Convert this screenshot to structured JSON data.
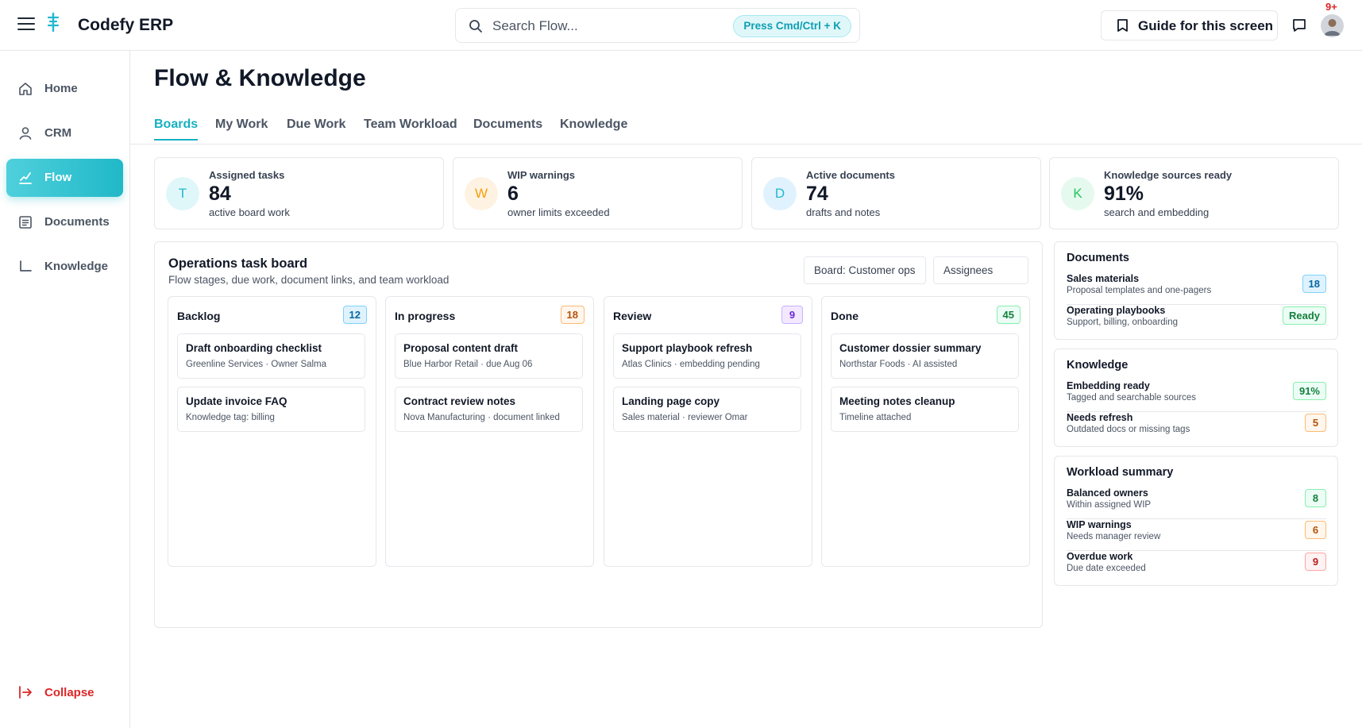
{
  "app": {
    "name": "Codefy ERP",
    "notifications": "9+"
  },
  "search": {
    "placeholder": "Search Flow...",
    "shortcut": "Press Cmd/Ctrl + K"
  },
  "header": {
    "guide_label": "Guide for this screen"
  },
  "sidebar": {
    "items": [
      {
        "label": "Home",
        "icon": "home-icon"
      },
      {
        "label": "CRM",
        "icon": "user-icon"
      },
      {
        "label": "Flow",
        "icon": "flow-icon",
        "active": true
      },
      {
        "label": "Documents",
        "icon": "document-icon"
      },
      {
        "label": "Knowledge",
        "icon": "knowledge-icon"
      }
    ],
    "collapse_label": "Collapse"
  },
  "page": {
    "title": "Flow & Knowledge",
    "tabs": [
      "Boards",
      "My Work",
      "Due Work",
      "Team Workload",
      "Documents",
      "Knowledge"
    ],
    "active_tab": "Boards"
  },
  "stats": [
    {
      "letter": "T",
      "label": "Assigned tasks",
      "value": "84",
      "sub": "active board work",
      "color": "#22b8cf"
    },
    {
      "letter": "W",
      "label": "WIP warnings",
      "value": "6",
      "sub": "owner limits exceeded",
      "color": "#f59e0b"
    },
    {
      "letter": "D",
      "label": "Active documents",
      "value": "74",
      "sub": "drafts and notes",
      "color": "#22b8cf"
    },
    {
      "letter": "K",
      "label": "Knowledge sources ready",
      "value": "91%",
      "sub": "search and embedding",
      "color": "#22c55e"
    }
  ],
  "board": {
    "title": "Operations task board",
    "subtitle": "Flow stages, due work, document links, and team workload",
    "filter_board": "Board: Customer ops",
    "filter_assignees": "Assignees",
    "columns": [
      {
        "title": "Backlog",
        "count": "12",
        "tasks": [
          {
            "title": "Draft onboarding checklist",
            "meta": "Greenline Services · Owner Salma"
          },
          {
            "title": "Update invoice FAQ",
            "meta": "Knowledge tag: billing"
          }
        ]
      },
      {
        "title": "In progress",
        "count": "18",
        "tasks": [
          {
            "title": "Proposal content draft",
            "meta": "Blue Harbor Retail · due Aug 06"
          },
          {
            "title": "Contract review notes",
            "meta": "Nova Manufacturing · document linked"
          }
        ]
      },
      {
        "title": "Review",
        "count": "9",
        "tasks": [
          {
            "title": "Support playbook refresh",
            "meta": "Atlas Clinics · embedding pending"
          },
          {
            "title": "Landing page copy",
            "meta": "Sales material · reviewer Omar"
          }
        ]
      },
      {
        "title": "Done",
        "count": "45",
        "tasks": [
          {
            "title": "Customer dossier summary",
            "meta": "Northstar Foods · AI assisted"
          },
          {
            "title": "Meeting notes cleanup",
            "meta": "Timeline attached"
          }
        ]
      }
    ]
  },
  "documents": {
    "title": "Documents",
    "items": [
      {
        "title": "Sales materials",
        "sub": "Proposal templates and one-pagers",
        "badge": "18"
      },
      {
        "title": "Operating playbooks",
        "sub": "Support, billing, onboarding",
        "badge": "Ready"
      }
    ]
  },
  "knowledge": {
    "title": "Knowledge",
    "items": [
      {
        "title": "Embedding ready",
        "sub": "Tagged and searchable sources",
        "badge": "91%"
      },
      {
        "title": "Needs refresh",
        "sub": "Outdated docs or missing tags",
        "badge": "5"
      }
    ]
  },
  "workload": {
    "title": "Workload summary",
    "items": [
      {
        "title": "Balanced owners",
        "sub": "Within assigned WIP",
        "badge": "8"
      },
      {
        "title": "WIP warnings",
        "sub": "Needs manager review",
        "badge": "6"
      },
      {
        "title": "Overdue work",
        "sub": "Due date exceeded",
        "badge": "9"
      }
    ]
  },
  "colors": {
    "accent": "#17b0c2",
    "danger": "#dc2626"
  }
}
